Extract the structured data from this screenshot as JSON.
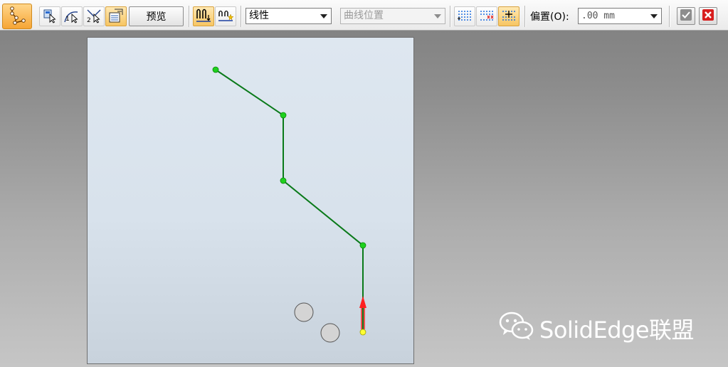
{
  "toolbar": {
    "main_icon": "curve-edit-icon",
    "select_buttons": [
      {
        "icon": "select-cursor-icon",
        "active": false
      },
      {
        "icon": "select-1-curve-icon",
        "active": false
      },
      {
        "icon": "select-2-curve-icon",
        "active": false
      },
      {
        "icon": "select-list-icon",
        "active": true
      }
    ],
    "preview_label": "预览",
    "mode_buttons": [
      {
        "icon": "mode-uniform-icon",
        "active": true
      },
      {
        "icon": "mode-spark-icon",
        "active": false
      }
    ],
    "type_select": {
      "value": "线性"
    },
    "position_select": {
      "value": "曲线位置",
      "disabled": true
    },
    "grid_buttons": [
      {
        "icon": "point-grid-icon",
        "active": false
      },
      {
        "icon": "point-grid-x-icon",
        "active": false
      },
      {
        "icon": "point-grid-plus-icon",
        "active": true
      }
    ],
    "offset_label": "偏置(O):",
    "offset_value": ".00 mm",
    "ok_icon": "check-icon",
    "cancel_icon": "close-icon"
  },
  "colors": {
    "curve": "#0a7a1a",
    "point": "#1fd01f",
    "start_point": "#ffff33",
    "arrow": "#ff2020",
    "circle_fill": "#d4d4d4"
  },
  "watermark": {
    "icon": "wechat-icon",
    "text": "SolidEdge联盟"
  }
}
